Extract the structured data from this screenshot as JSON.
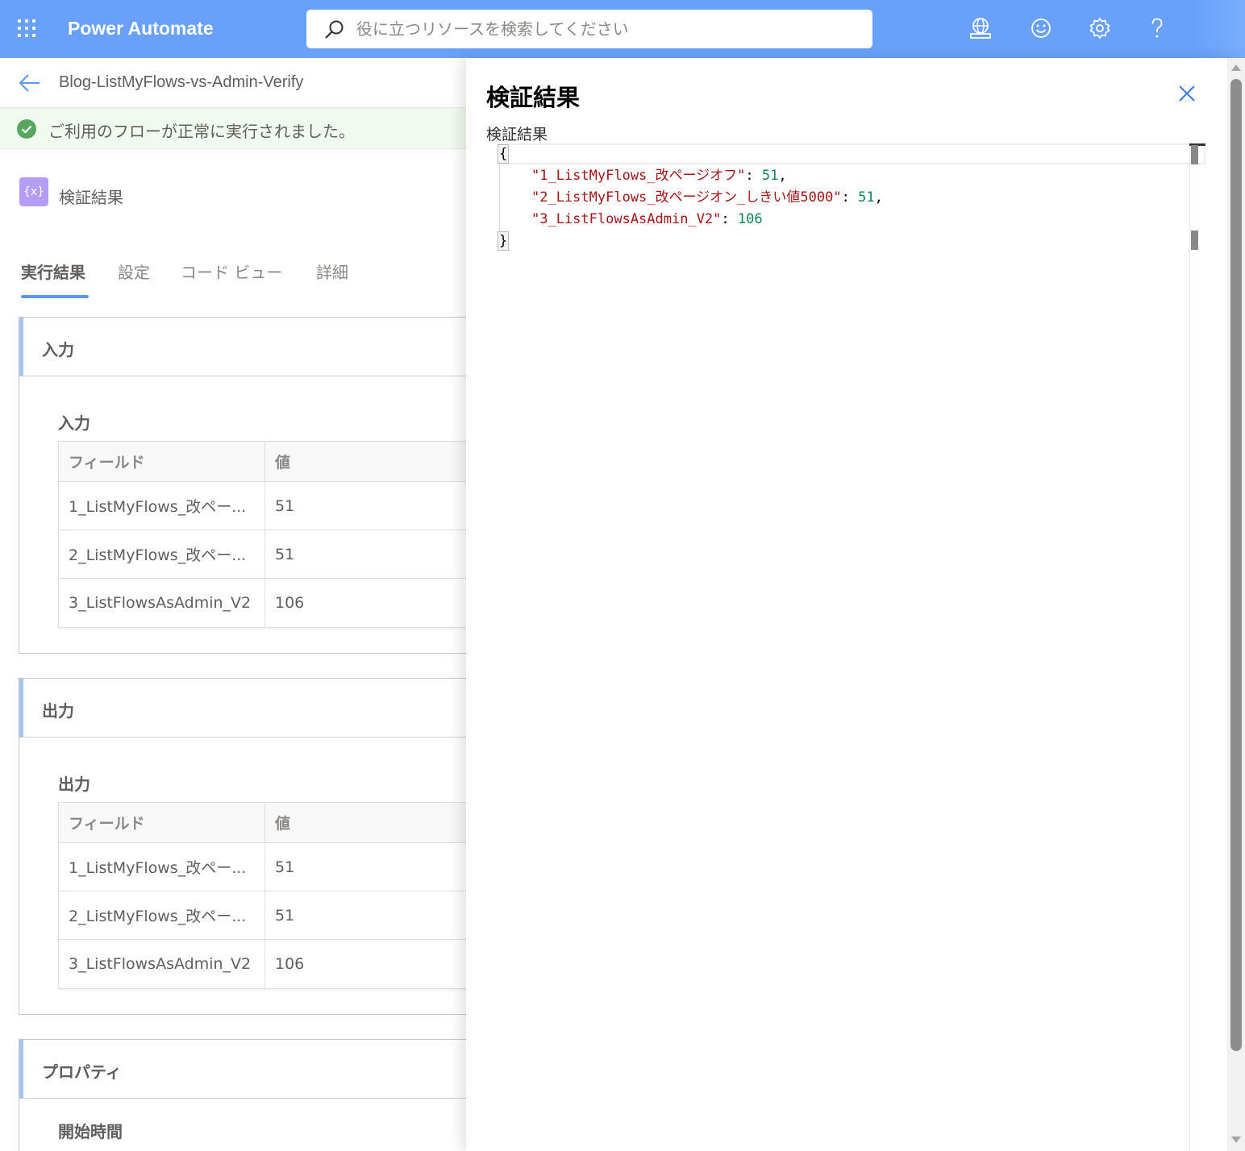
{
  "header": {
    "app_title": "Power Automate",
    "search_placeholder": "役に立つリソースを検索してください",
    "icons": [
      "app-launcher-icon",
      "environment-icon",
      "feedback-smiley-icon",
      "settings-gear-icon",
      "help-question-icon"
    ]
  },
  "page": {
    "flow_name": "Blog-ListMyFlows-vs-Admin-Verify",
    "success_message": "ご利用のフローが正常に実行されました。",
    "action_icon_text": "{x}",
    "action_name": "検証結果",
    "tabs": [
      {
        "label": "実行結果",
        "active": true
      },
      {
        "label": "設定",
        "active": false
      },
      {
        "label": "コード ビュー",
        "active": false
      },
      {
        "label": "詳細",
        "active": false
      }
    ],
    "inputs_section": {
      "title": "入力",
      "subtitle": "入力",
      "columns": [
        "フィールド",
        "値"
      ],
      "rows": [
        [
          "1_ListMyFlows_改ペー...",
          "51"
        ],
        [
          "2_ListMyFlows_改ペー...",
          "51"
        ],
        [
          "3_ListFlowsAsAdmin_V2",
          "106"
        ]
      ]
    },
    "outputs_section": {
      "title": "出力",
      "subtitle": "出力",
      "columns": [
        "フィールド",
        "値"
      ],
      "rows": [
        [
          "1_ListMyFlows_改ペー...",
          "51"
        ],
        [
          "2_ListMyFlows_改ペー...",
          "51"
        ],
        [
          "3_ListFlowsAsAdmin_V2",
          "106"
        ]
      ]
    },
    "properties_section": {
      "title": "プロパティ",
      "subtitle": "開始時間"
    }
  },
  "panel": {
    "title": "検証結果",
    "field_label": "検証結果",
    "json": {
      "open_brace": "{",
      "close_brace": "}",
      "entries": [
        {
          "key": "\"1_ListMyFlows_改ページオフ\"",
          "value": "51",
          "comma": ","
        },
        {
          "key": "\"2_ListMyFlows_改ページオン_しきい値5000\"",
          "value": "51",
          "comma": ","
        },
        {
          "key": "\"3_ListFlowsAsAdmin_V2\"",
          "value": "106",
          "comma": ""
        }
      ]
    }
  },
  "colors": {
    "topbar": "#69a1fa",
    "json_key": "#a31515",
    "json_number": "#098658",
    "success": "#5aa65f",
    "tab_underline": "#5b97f0"
  }
}
